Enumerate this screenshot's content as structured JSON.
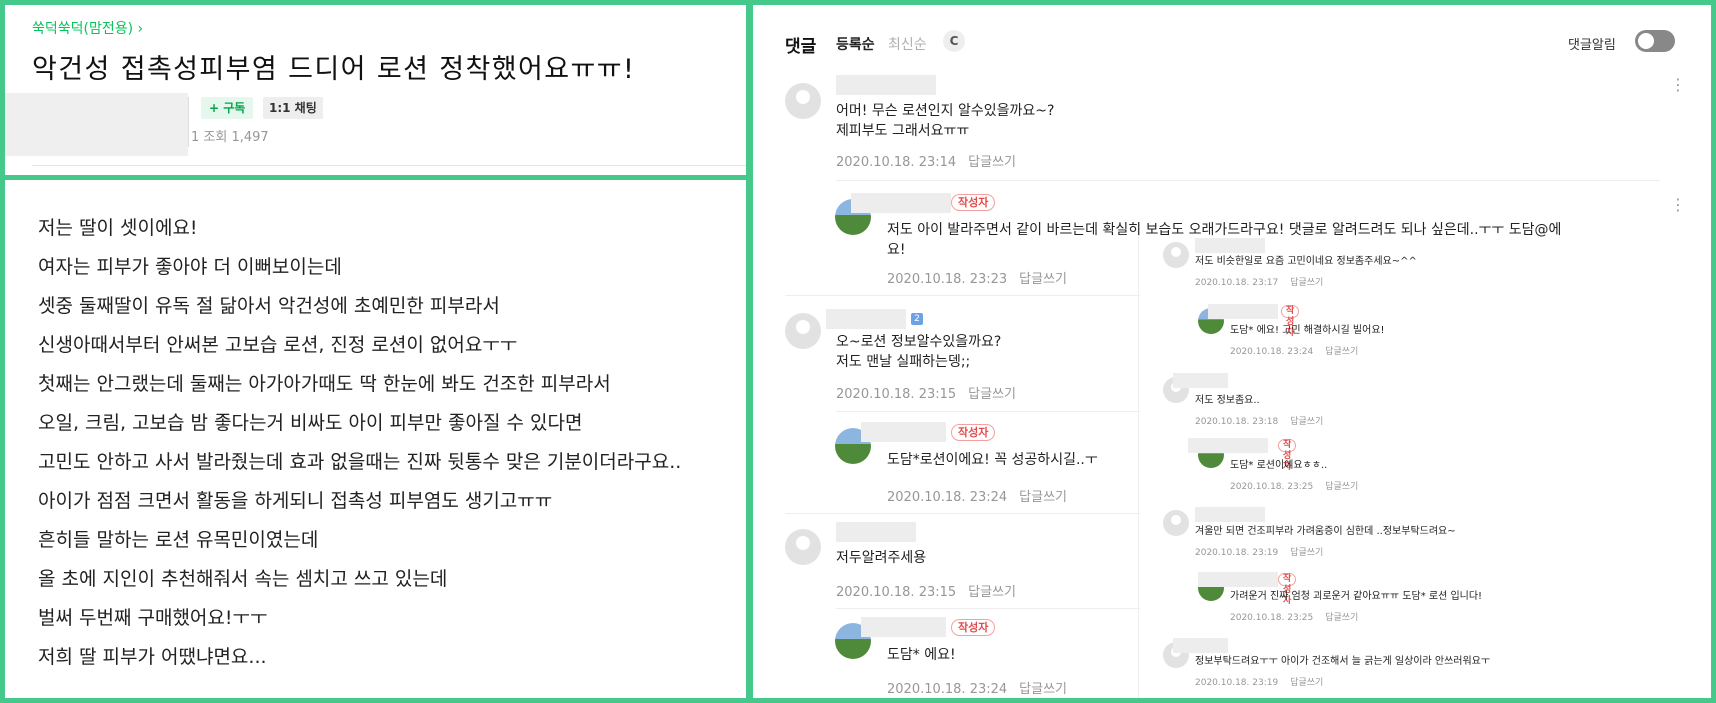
{
  "post": {
    "cafe_name": "쑥덕쑥덕(맘전용) ›",
    "title": "악건성 접촉성피부염 드디어 로션 정착했어요ㅠㅠ!",
    "subscribe_label": "+ 구독",
    "chat_label": "1:1 채팅",
    "views_label": "1  조회 1,497"
  },
  "body": {
    "lines": [
      "저는 딸이 셋이에요!",
      "여자는 피부가 좋아야 더 이뻐보이는데",
      "셋중 둘째딸이 유독 절 닮아서 악건성에 초예민한 피부라서",
      "신생아때서부터 안써본 고보습 로션, 진정 로션이 없어요ㅜㅜ",
      "첫째는 안그랬는데 둘째는 아가아가때도 딱 한눈에 봐도 건조한 피부라서",
      "오일, 크림, 고보습 밤 좋다는거 비싸도 아이 피부만 좋아질 수 있다면",
      "고민도 안하고 사서 발라줬는데 효과 없을때는 진짜 뒷통수 맞은 기분이더라구요..",
      "아이가 점점 크면서 활동을 하게되니 접촉성 피부염도 생기고ㅠㅠ",
      "흔히들 말하는 로션 유목민이였는데",
      "올 초에 지인이 추천해줘서 속는 셈치고 쓰고 있는데",
      "벌써 두번째 구매했어요!ㅜㅜ",
      "저희 딸 피부가 어땠냐면요..."
    ]
  },
  "comments_header": {
    "title": "댓글",
    "sort_registered": "등록순",
    "sort_latest": "최신순",
    "refresh_icon": "C",
    "alarm_label": "댓글알림"
  },
  "comments": [
    {
      "text1": "어머! 무슨 로션인지 알수있을까요~?",
      "text2": "제피부도 그래서요ㅠㅠ",
      "date": "2020.10.18. 23:14",
      "reply": "답글쓰기"
    },
    {
      "badge": "작성자",
      "text1": "저도 아이 발라주면서 같이 바르는데 확실히 보습도 오래가드라구요! 댓글로 알려드려도 되나 싶은데..ㅜㅜ 도담@에",
      "text2": "요!",
      "date": "2020.10.18. 23:23",
      "reply": "답글쓰기"
    },
    {
      "level": "2",
      "text1": "오~로션 정보알수있을까요?",
      "text2": "저도 맨날 실패하는뎅;;",
      "date": "2020.10.18. 23:15",
      "reply": "답글쓰기"
    },
    {
      "badge": "작성자",
      "text1": "도담*로션이에요! 꼭 성공하시길..ㅜ",
      "date": "2020.10.18. 23:24",
      "reply": "답글쓰기"
    },
    {
      "text1": "저두알려주세용",
      "date": "2020.10.18. 23:15",
      "reply": "답글쓰기"
    },
    {
      "badge": "작성자",
      "text1": "도담* 에요!",
      "date": "2020.10.18. 23:24",
      "reply": "답글쓰기"
    }
  ],
  "mini_comments": [
    {
      "text": "저도 비슷한일로 요즘 고민이네요 정보좀주세요~^^",
      "date": "2020.10.18. 23:17",
      "reply": "답글쓰기"
    },
    {
      "badge": "작성자",
      "text": "도담* 에요! 고민 해결하시길 빌어요!",
      "date": "2020.10.18. 23:24",
      "reply": "답글쓰기"
    },
    {
      "text": "저도 정보좀요..",
      "date": "2020.10.18. 23:18",
      "reply": "답글쓰기"
    },
    {
      "badge": "작성자",
      "text": "도담* 로션이에요ㅎㅎ..",
      "date": "2020.10.18. 23:25",
      "reply": "답글쓰기"
    },
    {
      "text": "겨울만 되면 건조피부라 가려움증이 심한데 ..정보부탁드려요~",
      "date": "2020.10.18. 23:19",
      "reply": "답글쓰기"
    },
    {
      "badge": "작성자",
      "text": "가려운거 진짜 엄청 괴로운거 같아요ㅠㅠ 도담* 로션 입니다!",
      "date": "2020.10.18. 23:25",
      "reply": "답글쓰기"
    },
    {
      "text": "정보부탁드려요ㅜㅜ 아이가 건조해서 늘 긁는게 일상이라 안쓰러워요ㅜ",
      "date": "2020.10.18. 23:19",
      "reply": "답글쓰기"
    }
  ],
  "colors": {
    "accent": "#03c75a",
    "frame": "#44c98b",
    "author_badge": "#e24b4b"
  }
}
